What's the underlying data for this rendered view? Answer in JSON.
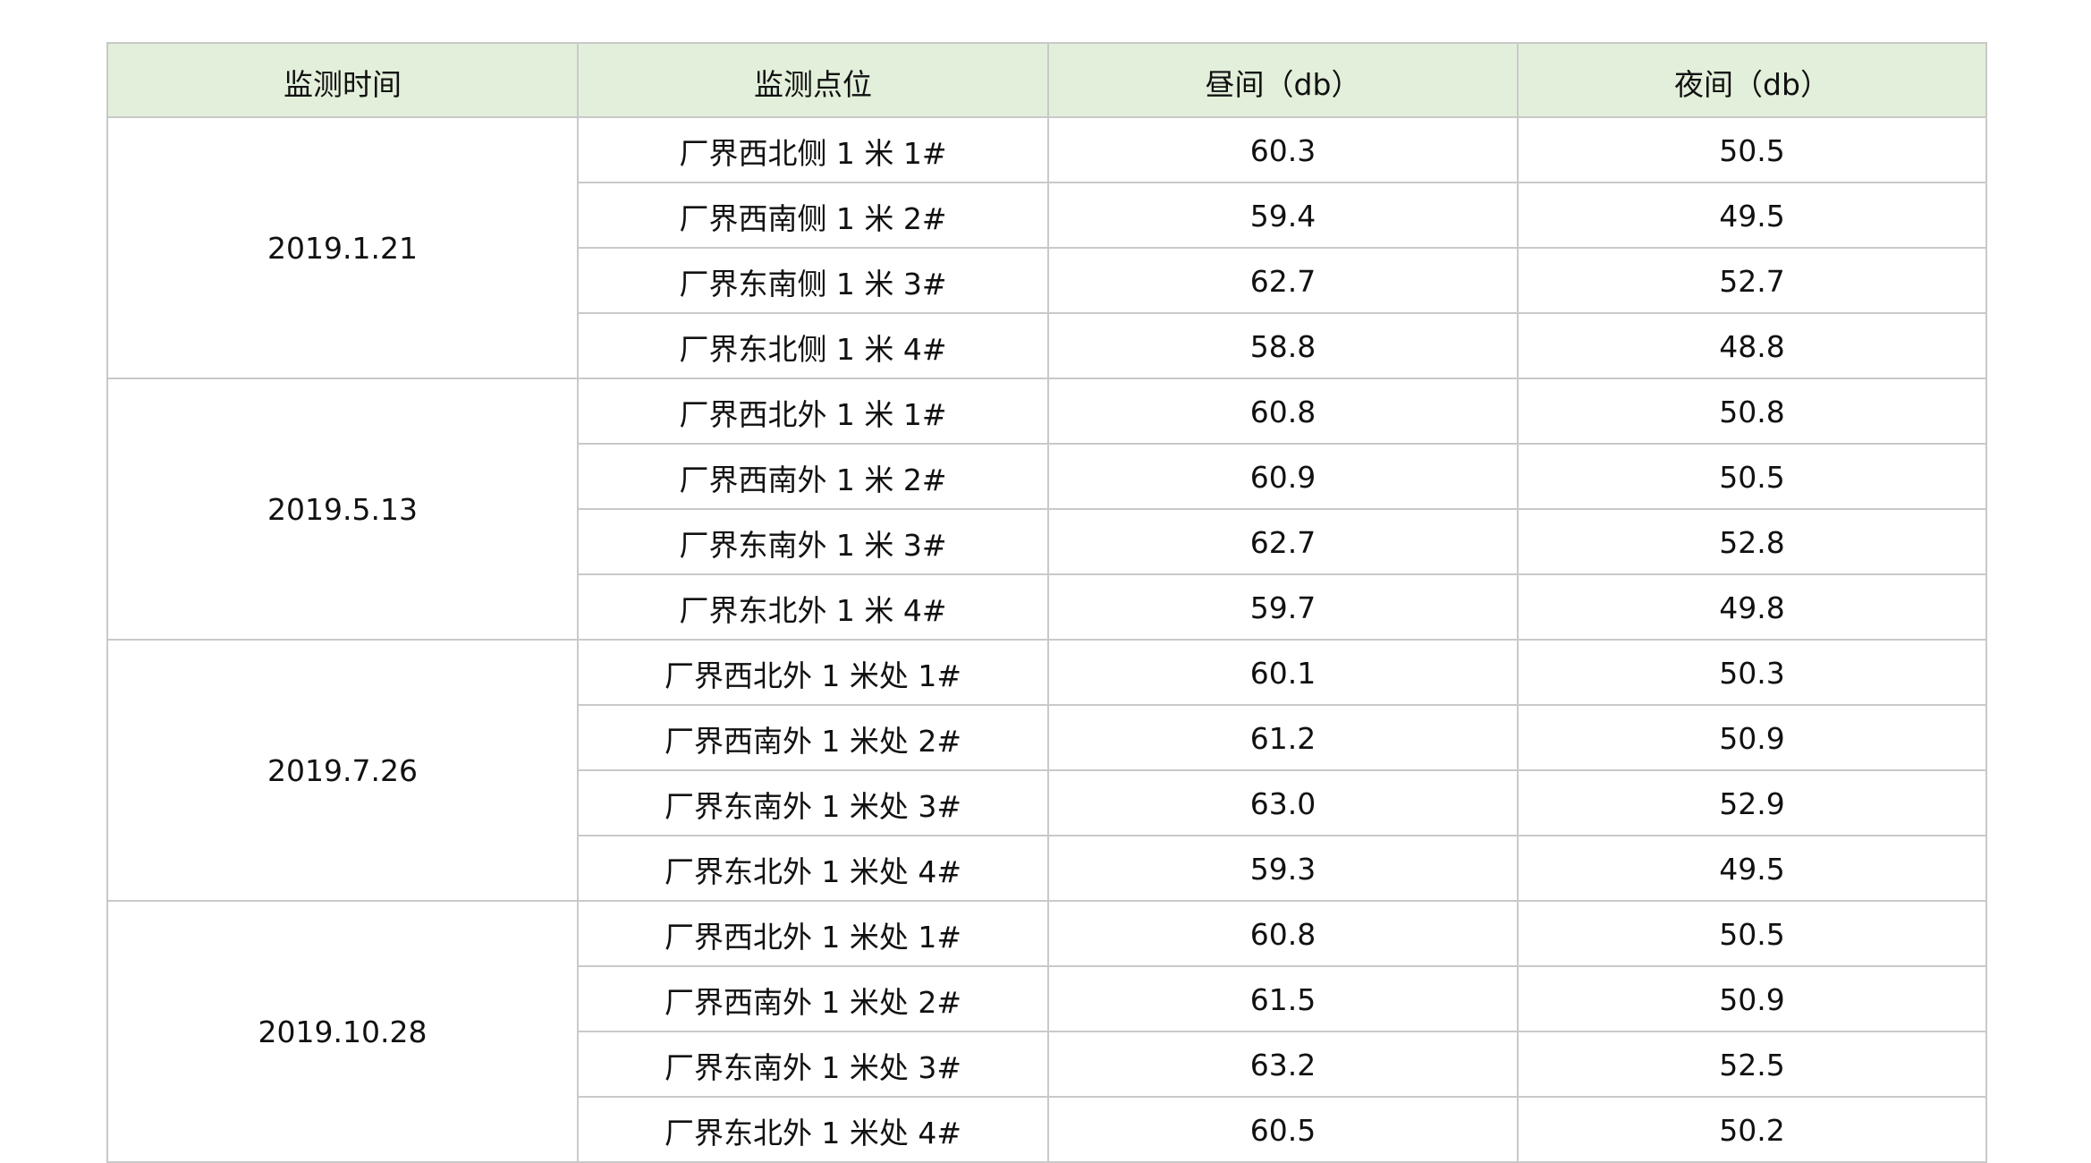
{
  "headers": [
    "监测时间",
    "监测点位",
    "昼间（db）",
    "夜间（db）"
  ],
  "groups": [
    {
      "date": "2019.1.21",
      "rows": [
        {
          "point": "厂界西北侧 1 米 1#",
          "day": "60.3",
          "night": "50.5"
        },
        {
          "point": "厂界西南侧 1 米 2#",
          "day": "59.4",
          "night": "49.5"
        },
        {
          "point": "厂界东南侧 1 米 3#",
          "day": "62.7",
          "night": "52.7"
        },
        {
          "point": "厂界东北侧 1 米 4#",
          "day": "58.8",
          "night": "48.8"
        }
      ]
    },
    {
      "date": "2019.5.13",
      "rows": [
        {
          "point": "厂界西北外 1 米 1#",
          "day": "60.8",
          "night": "50.8"
        },
        {
          "point": "厂界西南外 1 米 2#",
          "day": "60.9",
          "night": "50.5"
        },
        {
          "point": "厂界东南外 1 米 3#",
          "day": "62.7",
          "night": "52.8"
        },
        {
          "point": "厂界东北外 1 米 4#",
          "day": "59.7",
          "night": "49.8"
        }
      ]
    },
    {
      "date": "2019.7.26",
      "rows": [
        {
          "point": "厂界西北外 1 米处 1#",
          "day": "60.1",
          "night": "50.3"
        },
        {
          "point": "厂界西南外 1 米处 2#",
          "day": "61.2",
          "night": "50.9"
        },
        {
          "point": "厂界东南外 1 米处 3#",
          "day": "63.0",
          "night": "52.9"
        },
        {
          "point": "厂界东北外 1 米处 4#",
          "day": "59.3",
          "night": "49.5"
        }
      ]
    },
    {
      "date": "2019.10.28",
      "rows": [
        {
          "point": "厂界西北外 1 米处 1#",
          "day": "60.8",
          "night": "50.5"
        },
        {
          "point": "厂界西南外 1 米处 2#",
          "day": "61.5",
          "night": "50.9"
        },
        {
          "point": "厂界东南外 1 米处 3#",
          "day": "63.2",
          "night": "52.5"
        },
        {
          "point": "厂界东北外 1 米处 4#",
          "day": "60.5",
          "night": "50.2"
        }
      ]
    }
  ],
  "colors": {
    "header_background": "#e2efda",
    "border": "#c9c9c9",
    "text": "#111111"
  }
}
